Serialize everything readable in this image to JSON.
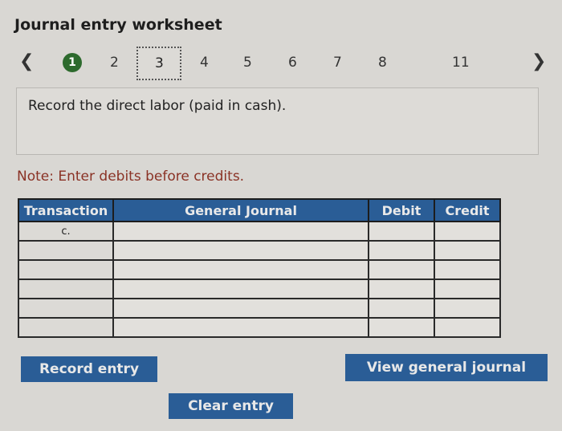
{
  "worksheet": {
    "title": "Journal entry worksheet",
    "prev_icon": "chevron-left-icon",
    "next_icon": "chevron-right-icon",
    "steps": [
      "1",
      "2",
      "3",
      "4",
      "5",
      "6",
      "7",
      "8",
      "11"
    ],
    "completed_step": "1",
    "current_step": "3"
  },
  "prompt": {
    "text": "Record the direct labor (paid in cash)."
  },
  "note": "Note: Enter debits before credits.",
  "journal": {
    "headers": [
      "Transaction",
      "General Journal",
      "Debit",
      "Credit"
    ],
    "rows": [
      {
        "transaction": "c.",
        "account": "",
        "debit": "",
        "credit": ""
      },
      {
        "transaction": "",
        "account": "",
        "debit": "",
        "credit": ""
      },
      {
        "transaction": "",
        "account": "",
        "debit": "",
        "credit": ""
      },
      {
        "transaction": "",
        "account": "",
        "debit": "",
        "credit": ""
      },
      {
        "transaction": "",
        "account": "",
        "debit": "",
        "credit": ""
      },
      {
        "transaction": "",
        "account": "",
        "debit": "",
        "credit": ""
      }
    ]
  },
  "buttons": {
    "record_entry": "Record entry",
    "view_general_journal": "View general journal",
    "clear_entry": "Clear entry"
  },
  "colors": {
    "header_blue": "#2a5d96",
    "completed_green": "#2d6a2d",
    "note_red": "#8a3225"
  }
}
